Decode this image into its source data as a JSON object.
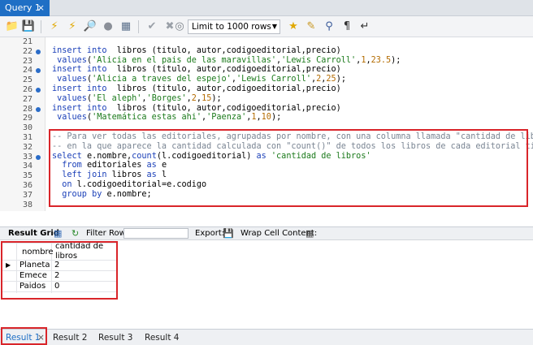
{
  "tabs": {
    "query_tab": "Query 1",
    "close_glyph": "×"
  },
  "toolbar": {
    "limit_label": "Limit to 1000 rows",
    "icons": [
      "folder-icon",
      "save-icon",
      "lightning-icon",
      "lightning-cursor-icon",
      "explain-icon",
      "stop-icon",
      "toggle-icon",
      "commit-icon",
      "rollback-icon",
      "autocommit-icon",
      "star-icon",
      "broom-icon",
      "search-icon",
      "pilcrow-icon",
      "wrap-icon"
    ]
  },
  "editor": {
    "lines": [
      {
        "n": "21",
        "dot": false,
        "parts": []
      },
      {
        "n": "22",
        "dot": true,
        "parts": [
          [
            "kw",
            "insert into"
          ],
          [
            "",
            "  libros (titulo, autor,codigoeditorial,precio)"
          ]
        ]
      },
      {
        "n": "23",
        "dot": false,
        "parts": [
          [
            "kw",
            " values"
          ],
          [
            "",
            "("
          ],
          [
            "str",
            "'Alicia en el pais de las maravillas'"
          ],
          [
            "",
            ","
          ],
          [
            "str",
            "'Lewis Carroll'"
          ],
          [
            "",
            ","
          ],
          [
            "num",
            "1"
          ],
          [
            "",
            ","
          ],
          [
            "num",
            "23.5"
          ],
          [
            "",
            ");"
          ]
        ]
      },
      {
        "n": "24",
        "dot": true,
        "parts": [
          [
            "kw",
            "insert into"
          ],
          [
            "",
            "  libros (titulo, autor,codigoeditorial,precio)"
          ]
        ]
      },
      {
        "n": "25",
        "dot": false,
        "parts": [
          [
            "kw",
            " values"
          ],
          [
            "",
            "("
          ],
          [
            "str",
            "'Alicia a traves del espejo'"
          ],
          [
            "",
            ","
          ],
          [
            "str",
            "'Lewis Carroll'"
          ],
          [
            "",
            ","
          ],
          [
            "num",
            "2"
          ],
          [
            "",
            ","
          ],
          [
            "num",
            "25"
          ],
          [
            "",
            ");"
          ]
        ]
      },
      {
        "n": "26",
        "dot": true,
        "parts": [
          [
            "kw",
            "insert into"
          ],
          [
            "",
            "  libros (titulo, autor,codigoeditorial,precio)"
          ]
        ]
      },
      {
        "n": "27",
        "dot": false,
        "parts": [
          [
            "kw",
            " values"
          ],
          [
            "",
            "("
          ],
          [
            "str",
            "'El aleph'"
          ],
          [
            "",
            ","
          ],
          [
            "str",
            "'Borges'"
          ],
          [
            "",
            ","
          ],
          [
            "num",
            "2"
          ],
          [
            "",
            ","
          ],
          [
            "num",
            "15"
          ],
          [
            "",
            ");"
          ]
        ]
      },
      {
        "n": "28",
        "dot": true,
        "parts": [
          [
            "kw",
            "insert into"
          ],
          [
            "",
            "  libros (titulo, autor,codigoeditorial,precio)"
          ]
        ]
      },
      {
        "n": "29",
        "dot": false,
        "parts": [
          [
            "kw",
            " values"
          ],
          [
            "",
            "("
          ],
          [
            "str",
            "'Matemática estas ahi'"
          ],
          [
            "",
            ","
          ],
          [
            "str",
            "'Paenza'"
          ],
          [
            "",
            ","
          ],
          [
            "num",
            "1"
          ],
          [
            "",
            ","
          ],
          [
            "num",
            "10"
          ],
          [
            "",
            ");"
          ]
        ]
      },
      {
        "n": "30",
        "dot": false,
        "parts": []
      },
      {
        "n": "31",
        "dot": false,
        "parts": [
          [
            "cm",
            "-- Para ver todas las editoriales, agrupadas por nombre, con una columna llamada \"cantidad de libros\""
          ]
        ]
      },
      {
        "n": "32",
        "dot": false,
        "parts": [
          [
            "cm",
            "-- en la que aparece la cantidad calculada con \"count()\" de todos los libros de cada editorial tipeamos:"
          ]
        ]
      },
      {
        "n": "33",
        "dot": true,
        "parts": [
          [
            "kw",
            "select"
          ],
          [
            "",
            " e.nombre,"
          ],
          [
            "kw",
            "count"
          ],
          [
            "",
            "(l.codigoeditorial) "
          ],
          [
            "kw",
            "as"
          ],
          [
            "",
            ""
          ],
          [
            "str",
            " 'cantidad de libros'"
          ]
        ]
      },
      {
        "n": "34",
        "dot": false,
        "parts": [
          [
            "kw",
            "  from"
          ],
          [
            "",
            " editoriales "
          ],
          [
            "kw",
            "as"
          ],
          [
            "",
            " e"
          ]
        ]
      },
      {
        "n": "35",
        "dot": false,
        "parts": [
          [
            "kw",
            "  left join"
          ],
          [
            "",
            " libros "
          ],
          [
            "kw",
            "as"
          ],
          [
            "",
            " l"
          ]
        ]
      },
      {
        "n": "36",
        "dot": false,
        "parts": [
          [
            "kw",
            "  on"
          ],
          [
            "",
            " l.codigoeditorial=e.codigo"
          ]
        ]
      },
      {
        "n": "37",
        "dot": false,
        "parts": [
          [
            "kw",
            "  group by"
          ],
          [
            "",
            " e.nombre;"
          ]
        ]
      },
      {
        "n": "38",
        "dot": false,
        "parts": []
      }
    ]
  },
  "results_toolbar": {
    "result_grid": "Result Grid",
    "filter_rows": "Filter Rows:",
    "export": "Export:",
    "wrap": "Wrap Cell Content:"
  },
  "grid": {
    "headers": [
      "nombre",
      "cantidad de\nlibros"
    ],
    "rows": [
      [
        "Planeta",
        "2"
      ],
      [
        "Emece",
        "2"
      ],
      [
        "Paidos",
        "0"
      ]
    ]
  },
  "bottom_tabs": [
    "Result 1",
    "Result 2",
    "Result 3",
    "Result 4"
  ]
}
